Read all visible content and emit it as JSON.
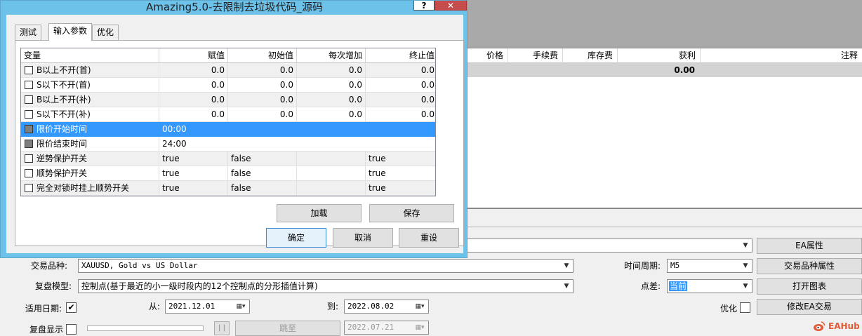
{
  "window": {
    "title": "Amazing5.0-去限制去垃圾代码_源码",
    "help_glyph": "?",
    "close_glyph": "✕"
  },
  "tabs": [
    {
      "label": "测试"
    },
    {
      "label": "输入参数"
    },
    {
      "label": "优化"
    }
  ],
  "grid": {
    "headers": [
      "变量",
      "赋值",
      "初始值",
      "每次增加",
      "终止值"
    ],
    "rows": [
      {
        "name": "B以上不开(首)",
        "value": "0.0",
        "start": "0.0",
        "step": "0.0",
        "stop": "0.0"
      },
      {
        "name": "S以下不开(首)",
        "value": "0.0",
        "start": "0.0",
        "step": "0.0",
        "stop": "0.0"
      },
      {
        "name": "B以上不开(补)",
        "value": "0.0",
        "start": "0.0",
        "step": "0.0",
        "stop": "0.0"
      },
      {
        "name": "S以下不开(补)",
        "value": "0.0",
        "start": "0.0",
        "step": "0.0",
        "stop": "0.0"
      },
      {
        "name": "限价开始时间",
        "value": "00:00",
        "start": "",
        "step": "",
        "stop": ""
      },
      {
        "name": "限价结束时间",
        "value": "24:00",
        "start": "",
        "step": "",
        "stop": ""
      },
      {
        "name": "逆势保护开关",
        "value": "true",
        "start": "false",
        "step": "",
        "stop": "true"
      },
      {
        "name": "顺势保护开关",
        "value": "true",
        "start": "false",
        "step": "",
        "stop": "true"
      },
      {
        "name": "完全对锁时挂上顺势开关",
        "value": "true",
        "start": "false",
        "step": "",
        "stop": "true"
      }
    ]
  },
  "buttons": {
    "load": "加载",
    "save": "保存",
    "ok": "确定",
    "cancel": "取消",
    "reset": "重设"
  },
  "background_table": {
    "headers": [
      "价格",
      "手续费",
      "库存费",
      "获利",
      "注释"
    ],
    "profit_value": "0.00"
  },
  "settings": {
    "symbol_label": "交易品种:",
    "symbol_value": "XAUUSD, Gold vs US Dollar",
    "model_label": "复盘模型:",
    "model_value": "控制点(基于最近的小一级时段内的12个控制点的分形插值计算)",
    "use_date_label": "适用日期:",
    "use_date_checked": "✔",
    "from_label": "从:",
    "from_value": "2021.12.01",
    "to_label": "到:",
    "to_value": "2022.08.02",
    "visual_label": "复盘显示",
    "pause_glyph": "| |",
    "jump_label": "跳至",
    "jump_date": "2022.07.21",
    "period_label": "时间周期:",
    "period_value": "M5",
    "spread_label": "点差:",
    "spread_value": "当前",
    "optimize_label": "优化",
    "ea_props": "EA属性",
    "symbol_props": "交易品种属性",
    "open_chart": "打开图表",
    "modify_ea": "修改EA交易"
  },
  "watermark": "EAHub",
  "colors": {
    "title_bar": "#6dc2e9",
    "selection": "#3399ff",
    "close_button": "#c74d4d",
    "logo": "#e35a36"
  }
}
